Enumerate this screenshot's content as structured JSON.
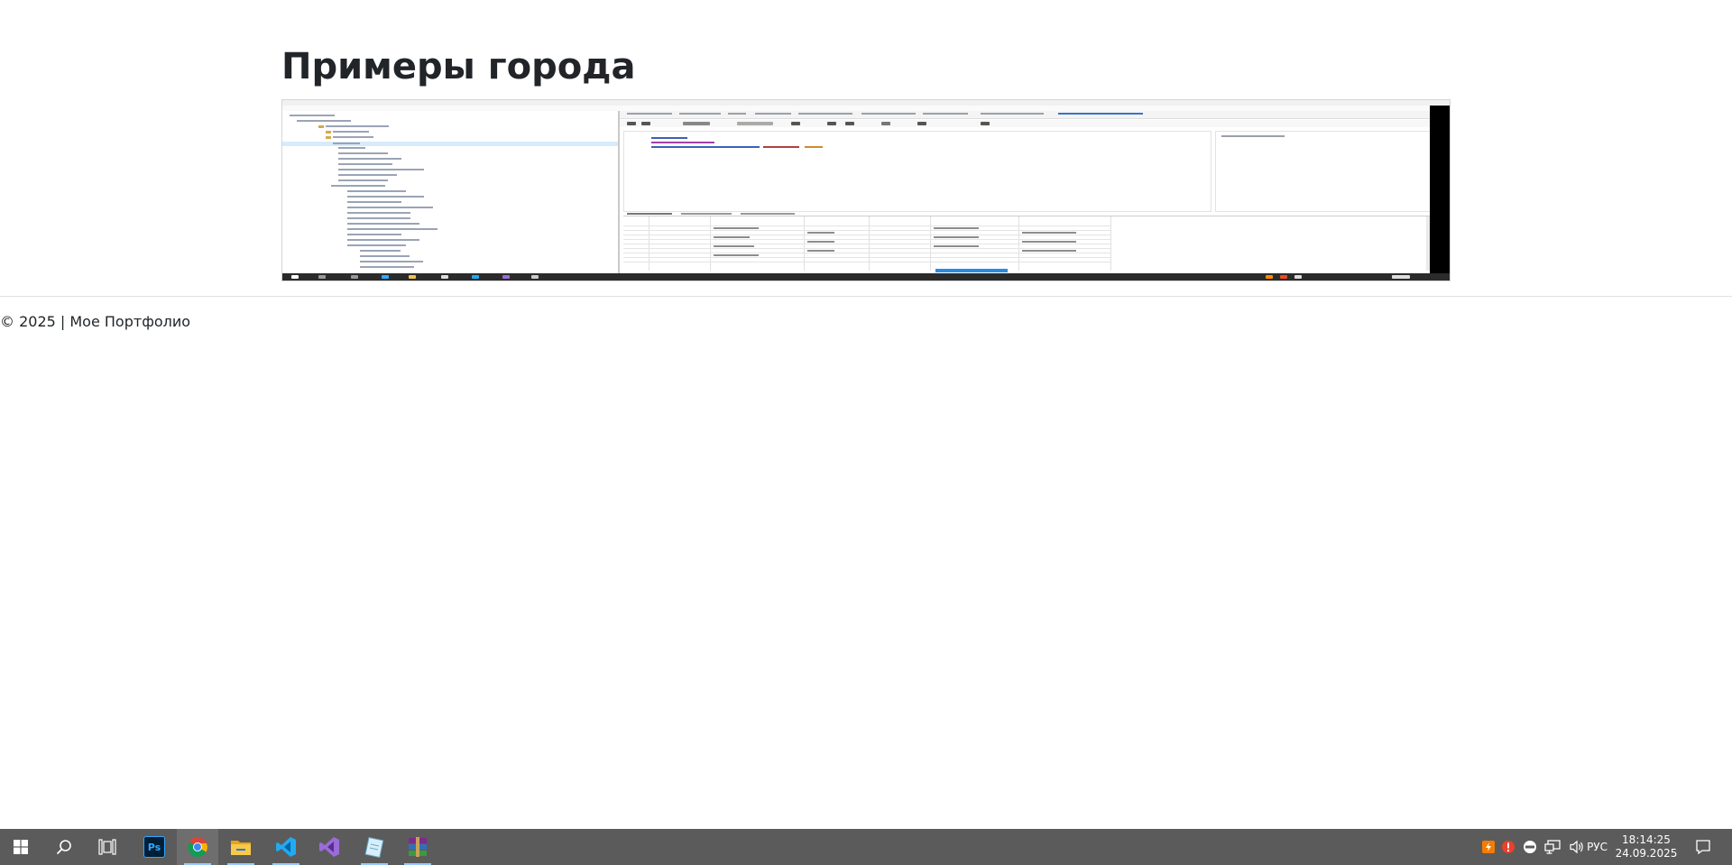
{
  "page": {
    "title": "Примеры города",
    "footer": "© 2025 | Мое Портфолио"
  },
  "taskbar": {
    "apps": [
      {
        "name": "start",
        "icon": "windows-logo-icon"
      },
      {
        "name": "search",
        "icon": "search-icon"
      },
      {
        "name": "task-view",
        "icon": "task-view-icon"
      },
      {
        "name": "photoshop",
        "icon": "photoshop-icon",
        "label": "Ps"
      },
      {
        "name": "chrome",
        "icon": "chrome-icon"
      },
      {
        "name": "file-explorer",
        "icon": "folder-icon"
      },
      {
        "name": "vscode",
        "icon": "vscode-icon"
      },
      {
        "name": "visual-studio",
        "icon": "visual-studio-icon"
      },
      {
        "name": "notepad",
        "icon": "notepad-icon"
      },
      {
        "name": "winrar",
        "icon": "winrar-icon"
      }
    ],
    "tray": {
      "language": "РУС",
      "time": "18:14:25",
      "date": "24.09.2025"
    }
  },
  "colors": {
    "taskbar_bg": "#5b5b5b",
    "active_underline": "#99c9ff",
    "photoshop": "#31a8ff",
    "vscode": "#23a9f2",
    "visual_studio": "#9b6cd8"
  }
}
